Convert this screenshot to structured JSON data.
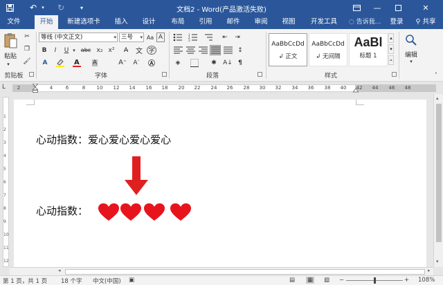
{
  "window": {
    "title": "文档2 - Word(产品激活失败)"
  },
  "quick_access": {
    "save_icon": "save-icon",
    "undo_icon": "undo-icon",
    "redo_icon": "redo-icon"
  },
  "tabs": [
    {
      "label": "文件"
    },
    {
      "label": "开始"
    },
    {
      "label": "新建选项卡"
    },
    {
      "label": "插入"
    },
    {
      "label": "设计"
    },
    {
      "label": "布局"
    },
    {
      "label": "引用"
    },
    {
      "label": "邮件"
    },
    {
      "label": "审阅"
    },
    {
      "label": "视图"
    },
    {
      "label": "开发工具"
    }
  ],
  "tellme": "告诉我...",
  "login": "登录",
  "share": "共享",
  "ribbon": {
    "clipboard": {
      "paste_label": "粘贴",
      "group_label": "剪贴板"
    },
    "font": {
      "font_name": "等线 (中文正文)",
      "font_size": "三号",
      "bold": "B",
      "italic": "I",
      "underline": "U",
      "strike": "abc",
      "sub": "x₂",
      "sup": "x²",
      "group_label": "字体"
    },
    "paragraph": {
      "group_label": "段落"
    },
    "styles": {
      "items": [
        {
          "preview": "AaBbCcDd",
          "name": "↲ 正文"
        },
        {
          "preview": "AaBbCcDd",
          "name": "↲ 无间隔"
        },
        {
          "preview": "AaBl",
          "name": "标题 1"
        }
      ],
      "group_label": "样式"
    },
    "editing": {
      "label": "编辑"
    }
  },
  "ruler": {
    "ticks": [
      "2",
      "2",
      "4",
      "6",
      "8",
      "10",
      "12",
      "14",
      "16",
      "18",
      "20",
      "22",
      "24",
      "26",
      "28",
      "30",
      "32",
      "34",
      "36",
      "38",
      "40",
      "42",
      "44",
      "46",
      "48"
    ],
    "corner": "L"
  },
  "document": {
    "line1": "心动指数：爱心爱心爱心爱心",
    "line2_label": "心动指数：",
    "heart_count": 4,
    "arrow_color": "#e02020",
    "heart_color": "#e8141d"
  },
  "status": {
    "page": "第 1 页，共 1 页",
    "words": "18 个字",
    "lang": "中文(中国)",
    "zoom": "108%"
  },
  "colors": {
    "brand": "#2b579a"
  }
}
